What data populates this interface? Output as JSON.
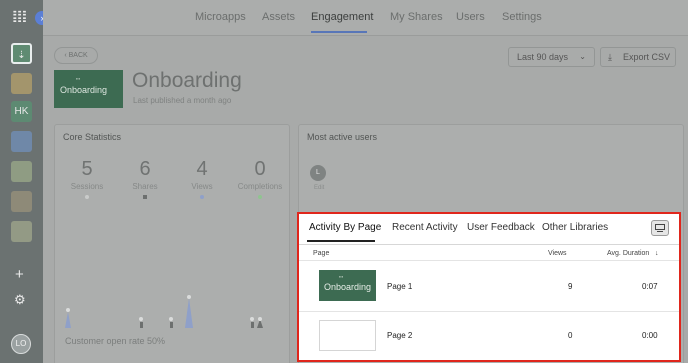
{
  "sidebar": {
    "logo": "𝍖",
    "collapse_icon": "›",
    "items": [
      {
        "label": "⇣",
        "icon": "import-icon"
      },
      {
        "label": "",
        "icon": "app-tile-icon"
      },
      {
        "label": "HK",
        "icon": "hk-tile-icon"
      },
      {
        "label": "",
        "icon": "app-tile-icon"
      },
      {
        "label": "",
        "icon": "app-tile-icon"
      },
      {
        "label": "",
        "icon": "app-tile-icon"
      },
      {
        "label": "",
        "icon": "app-tile-icon"
      }
    ],
    "add_label": "+",
    "settings_label": "⚙",
    "avatar_initials": "LO"
  },
  "nav": {
    "items": [
      "Microapps",
      "Assets",
      "Engagement",
      "My Shares",
      "Users",
      "Settings"
    ],
    "active": "Engagement"
  },
  "header": {
    "back_label": "‹ BACK",
    "range_label": "Last 90 days",
    "range_chevron": "⌄",
    "export_label": "Export CSV",
    "export_icon": "⤓",
    "title": "Onboarding",
    "subtitle": "Last published a month ago",
    "thumb_label": "Onboarding"
  },
  "core_stats": {
    "title": "Core Statistics",
    "stats": [
      {
        "value": "5",
        "label": "Sessions",
        "color": "#c9cbca"
      },
      {
        "value": "6",
        "label": "Shares",
        "color": "#6d706f"
      },
      {
        "value": "4",
        "label": "Views",
        "color": "#8fa0c9"
      },
      {
        "value": "0",
        "label": "Completions",
        "color": "#8fc58f"
      }
    ],
    "open_rate": "Customer open rate 50%"
  },
  "active_users": {
    "title": "Most active users",
    "user_initial": "L",
    "user_name": "Edit"
  },
  "panel": {
    "tabs": [
      "Activity By Page",
      "Recent Activity",
      "User Feedback",
      "Other Libraries"
    ],
    "active_tab": "Activity By Page",
    "columns": {
      "page": "Page",
      "views": "Views",
      "duration": "Avg. Duration",
      "sort_icon": "↓"
    },
    "rows": [
      {
        "name": "Page 1",
        "views": "9",
        "duration": "0:07",
        "thumb_label": "Onboarding"
      },
      {
        "name": "Page 2",
        "views": "0",
        "duration": "0:00",
        "thumb_label": ""
      }
    ]
  },
  "colors": {
    "accent": "#5876b8",
    "highlight": "#e0261c",
    "thumb_green": "#3d6b52"
  }
}
